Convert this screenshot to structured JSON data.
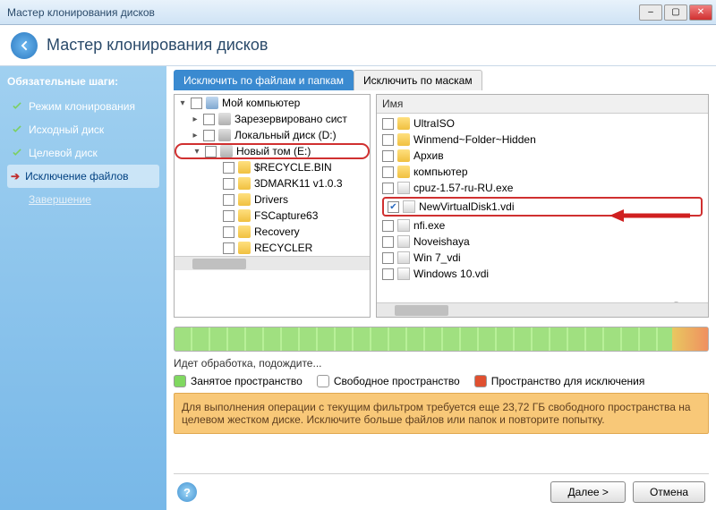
{
  "titlebar": {
    "title": "Мастер клонирования дисков"
  },
  "header": {
    "title": "Мастер клонирования дисков"
  },
  "sidebar": {
    "heading": "Обязательные шаги:",
    "steps": [
      {
        "label": "Режим клонирования",
        "done": true
      },
      {
        "label": "Исходный диск",
        "done": true
      },
      {
        "label": "Целевой диск",
        "done": true
      },
      {
        "label": "Исключение файлов",
        "active": true
      },
      {
        "label": "Завершение",
        "pending": true
      }
    ]
  },
  "tabs": {
    "active": "Исключить по файлам и папкам",
    "other": "Исключить по маскам"
  },
  "tree": {
    "root": "Мой компьютер",
    "items": [
      {
        "level": 1,
        "icon": "drive",
        "label": "Зарезервировано сист"
      },
      {
        "level": 1,
        "icon": "drive",
        "label": "Локальный диск (D:)"
      },
      {
        "level": 1,
        "icon": "drive",
        "label": "Новый том (E:)",
        "expanded": true,
        "highlighted": true
      },
      {
        "level": 3,
        "icon": "folder",
        "label": "$RECYCLE.BIN"
      },
      {
        "level": 3,
        "icon": "folder",
        "label": "3DMARK11 v1.0.3"
      },
      {
        "level": 3,
        "icon": "folder",
        "label": "Drivers"
      },
      {
        "level": 3,
        "icon": "folder",
        "label": "FSCapture63"
      },
      {
        "level": 3,
        "icon": "folder",
        "label": "Recovery"
      },
      {
        "level": 3,
        "icon": "folder",
        "label": "RECYCLER"
      }
    ]
  },
  "list": {
    "header": "Имя",
    "items": [
      {
        "icon": "folder",
        "label": "UltraISO"
      },
      {
        "icon": "folder",
        "label": "Winmend~Folder~Hidden"
      },
      {
        "icon": "folder",
        "label": "Архив"
      },
      {
        "icon": "folder",
        "label": "компьютер"
      },
      {
        "icon": "file",
        "label": "cpuz-1.57-ru-RU.exe"
      },
      {
        "icon": "file",
        "label": "NewVirtualDisk1.vdi",
        "checked": true,
        "highlighted": true
      },
      {
        "icon": "file",
        "label": "nfi.exe"
      },
      {
        "icon": "file",
        "label": "Noveishaya"
      },
      {
        "icon": "file",
        "label": "Win 7_vdi"
      },
      {
        "icon": "file",
        "label": "Windows 10.vdi"
      }
    ]
  },
  "status": "Идет обработка, подождите...",
  "legend": {
    "used": "Занятое пространство",
    "free": "Свободное пространство",
    "excl": "Пространство для исключения"
  },
  "warning": "Для выполнения операции с текущим фильтром требуется еще 23,72 ГБ свободного пространства на целевом жестком диске. Исключите больше файлов или папок и повторите попытку.",
  "footer": {
    "next": "Далее >",
    "cancel": "Отмена"
  }
}
